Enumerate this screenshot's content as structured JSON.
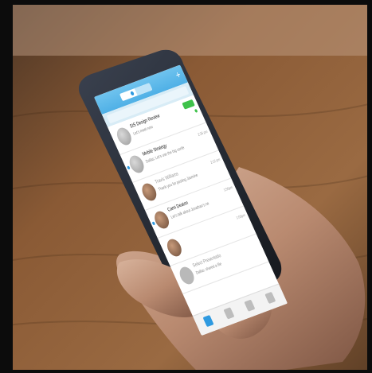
{
  "scene": "hand holding a smartphone with a messaging app over a wooden table",
  "colors": {
    "accent": "#2f9ae0",
    "online": "#3fc24a",
    "table": "#8a5a35"
  },
  "app": {
    "rows": [
      {
        "name": "SIS Design Review",
        "message": "Let's meet now",
        "time": "",
        "avatar": "group",
        "unread": false
      },
      {
        "name": "Mobile Strategy",
        "message": "Dallas: Let's use the big confe",
        "time": "2:35 pm",
        "avatar": "group",
        "unread": true
      },
      {
        "name": "Travis Williams",
        "message": "Thank you for posting Jasmine",
        "time": "2:12 pm",
        "avatar": "person",
        "unread": false
      },
      {
        "name": "Cami Deaton",
        "message": "Let's talk about Jonathan's ne",
        "time": "1:56pm",
        "avatar": "person",
        "unread": true
      },
      {
        "name": "",
        "message": "",
        "time": "1:05pm",
        "avatar": "person",
        "unread": false
      },
      {
        "name": "Select Presentatio",
        "message": "Dallas: shared a file",
        "time": "",
        "avatar": "grey",
        "unread": false
      }
    ],
    "tabs": [
      {
        "icon": "chat-icon",
        "active": true
      },
      {
        "icon": "contacts-icon",
        "active": false
      },
      {
        "icon": "calendar-icon",
        "active": false
      },
      {
        "icon": "gear-icon",
        "active": false
      }
    ]
  }
}
